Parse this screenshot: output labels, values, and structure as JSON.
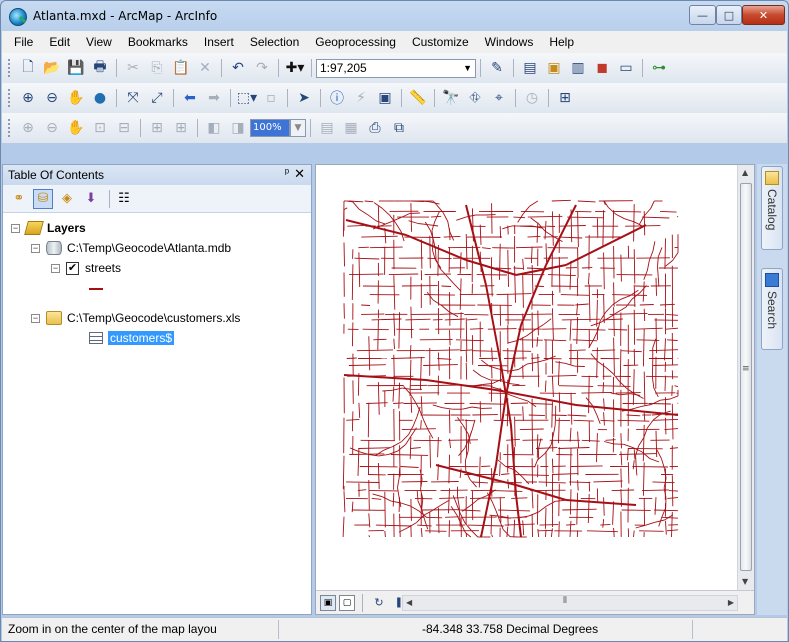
{
  "window": {
    "title": "Atlanta.mxd - ArcMap - ArcInfo",
    "controls": {
      "minimize": "—",
      "maximize": "□",
      "close": "✕"
    }
  },
  "menu": [
    "File",
    "Edit",
    "View",
    "Bookmarks",
    "Insert",
    "Selection",
    "Geoprocessing",
    "Customize",
    "Windows",
    "Help"
  ],
  "toolbar": {
    "scale_value": "1:97,205",
    "zoom_percent": "100%"
  },
  "toc": {
    "title": "Table Of Contents",
    "pin": "ᵖ",
    "close": "✕",
    "layers_label": "Layers",
    "datasource1": "C:\\Temp\\Geocode\\Atlanta.mdb",
    "layer_streets": "streets",
    "datasource2": "C:\\Temp\\Geocode\\customers.xls",
    "table_customers": "customers$"
  },
  "map": {
    "street_color": "#a50f15"
  },
  "dock": {
    "catalog_label": "Catalog",
    "search_label": "Search"
  },
  "status": {
    "message": "Zoom in on the center of the map layou",
    "coordinates": "-84.348  33.758 Decimal Degrees"
  }
}
